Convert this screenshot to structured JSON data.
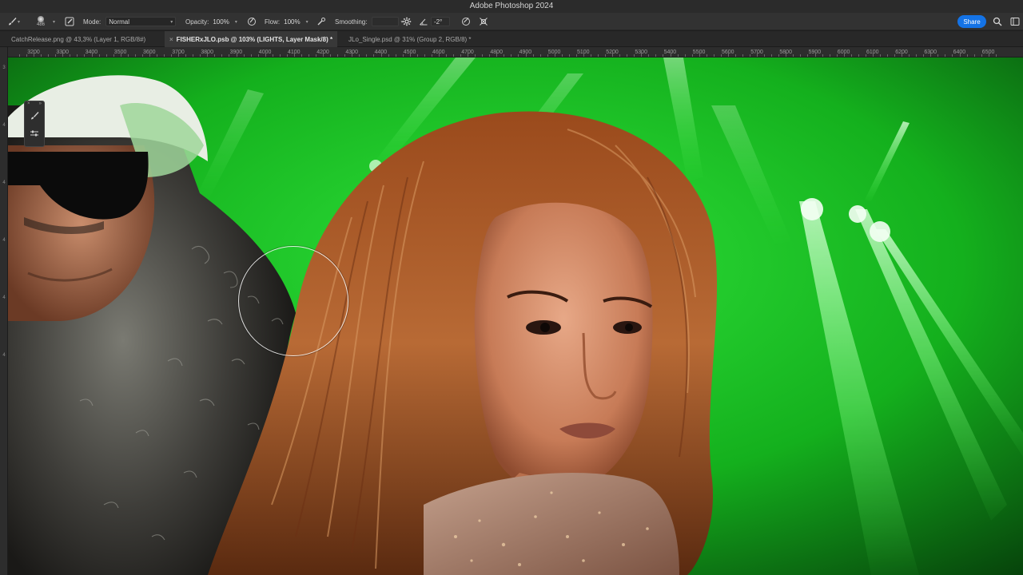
{
  "window": {
    "title": "Adobe Photoshop 2024"
  },
  "options": {
    "brush_size": "486",
    "mode_label": "Mode:",
    "mode_value": "Normal",
    "opacity_label": "Opacity:",
    "opacity_value": "100%",
    "flow_label": "Flow:",
    "flow_value": "100%",
    "smoothing_label": "Smoothing:",
    "smoothing_value": "",
    "angle_value": "-2°",
    "share_label": "Share"
  },
  "tabs": [
    {
      "label": "CatchRelease.png @ 43,3% (Layer 1, RGB/8#)",
      "active": false
    },
    {
      "label": "FISHERxJLO.psb @ 103% (LIGHTS, Layer Mask/8) *",
      "active": true
    },
    {
      "label": "JLo_Single.psd @ 31% (Group 2, RGB/8) *",
      "active": false
    }
  ],
  "ruler": {
    "h_ticks": [
      "3200",
      "3300",
      "3400",
      "3500",
      "3600",
      "3700",
      "3800",
      "3900",
      "4000",
      "4100",
      "4200",
      "4300",
      "4400",
      "4500",
      "4600",
      "4700",
      "4800",
      "4900",
      "5000",
      "5100",
      "5200",
      "5300",
      "5400",
      "5500",
      "5600",
      "5700",
      "5800",
      "5900",
      "6000",
      "6100",
      "6200",
      "6300",
      "6400",
      "6500"
    ],
    "v_ticks": [
      "3",
      "4",
      "4",
      "4",
      "4",
      "4"
    ]
  },
  "icons": {
    "brush": "brush-icon",
    "brush_settings": "brush-settings-icon",
    "airbrush": "airbrush-icon",
    "pressure_opacity": "pressure-opacity-icon",
    "pressure_flow": "pressure-flow-icon",
    "gear": "gear-icon",
    "angle": "angle-icon",
    "pressure_size": "pressure-size-icon",
    "symmetry": "symmetry-icon",
    "search": "search-icon",
    "panel": "panel-icon"
  },
  "colors": {
    "accent": "#1473e6",
    "chrome": "#323232",
    "canvas_bg": "#16c41c"
  }
}
